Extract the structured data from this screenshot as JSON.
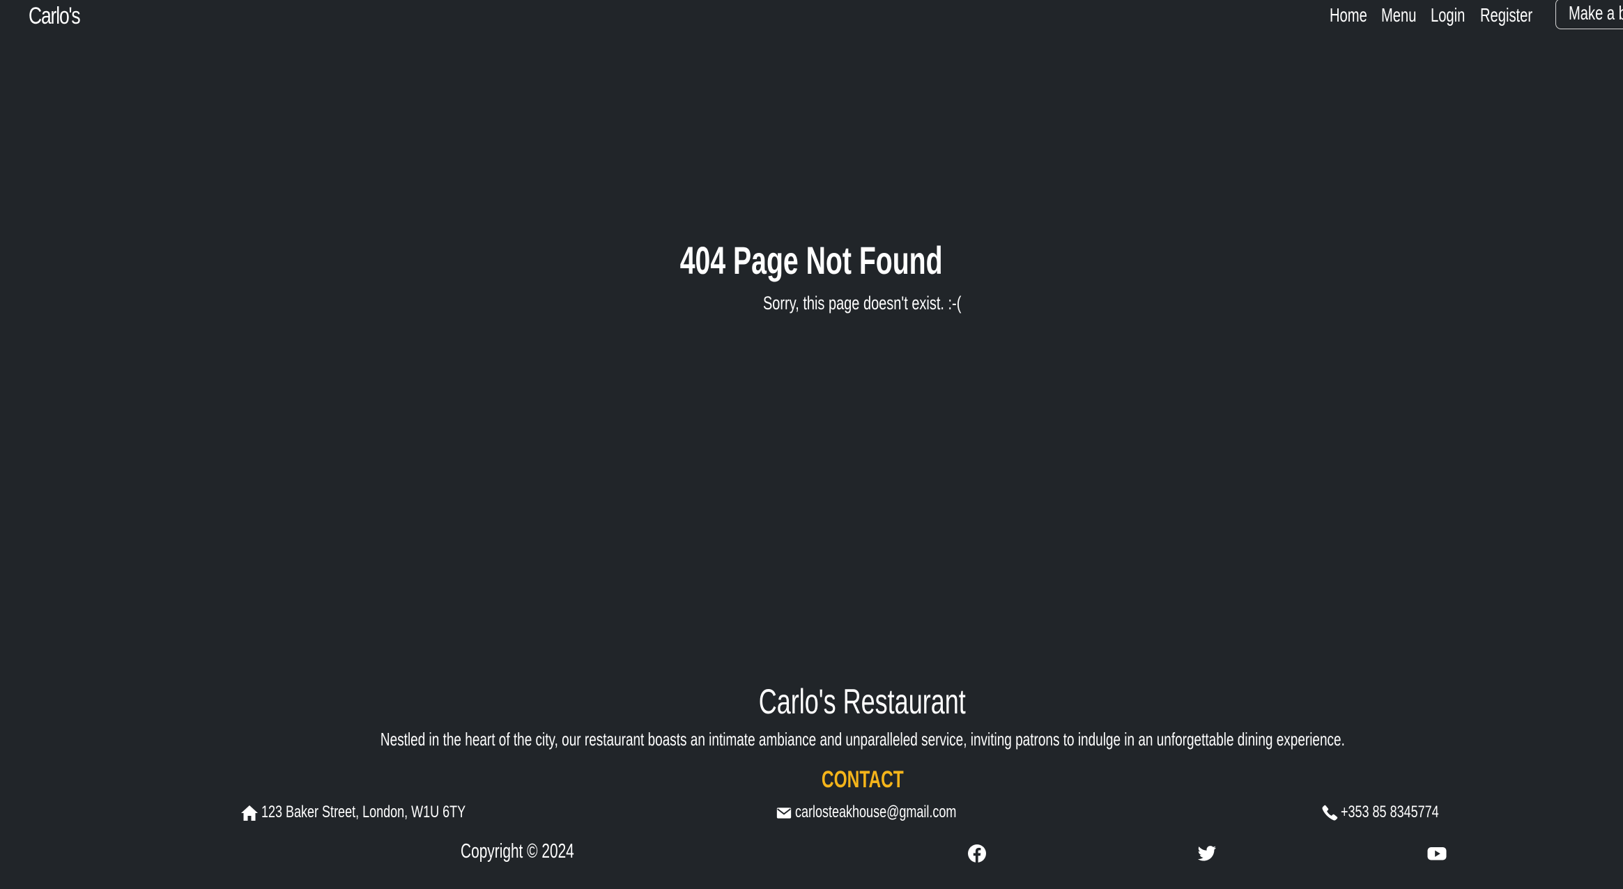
{
  "navbar": {
    "brand": "Carlo's",
    "links": [
      "Home",
      "Menu",
      "Login",
      "Register"
    ],
    "book_button": "Make a booking"
  },
  "main": {
    "title": "404 Page Not Found",
    "subtitle": "Sorry, this page doesn't exist. :-("
  },
  "footer": {
    "title": "Carlo's Restaurant",
    "description": "Nestled in the heart of the city, our restaurant boasts an intimate ambiance and unparalleled service, inviting patrons to indulge in an unforgettable dining experience.",
    "contact_heading": "CONTACT",
    "address": "123 Baker Street, London, W1U 6TY",
    "email": "carlosteakhouse@gmail.com",
    "phone": "+353 85 8345774",
    "copyright": "Copyright © 2024",
    "social_icons": [
      "facebook-icon",
      "twitter-icon",
      "youtube-icon"
    ]
  },
  "colors": {
    "background": "#212529",
    "text": "#ffffff",
    "accent": "#f4b41a"
  }
}
